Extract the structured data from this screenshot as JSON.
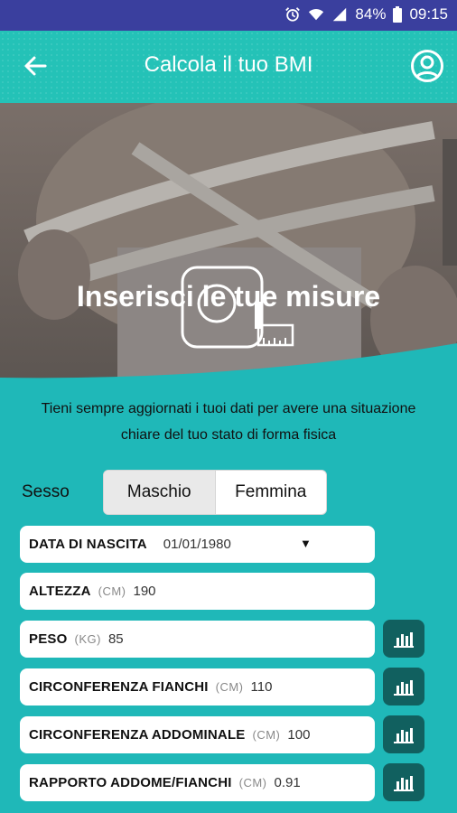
{
  "status": {
    "battery": "84%",
    "time": "09:15"
  },
  "appbar": {
    "title": "Calcola il tuo BMI"
  },
  "hero": {
    "heading": "Inserisci le tue misure"
  },
  "intro": {
    "line1": "Tieni sempre aggiornati i tuoi dati per avere una situazione",
    "line2": "chiare del tuo stato di forma fisica"
  },
  "sex": {
    "label": "Sesso",
    "options": [
      "Maschio",
      "Femmina"
    ],
    "selected": "Maschio"
  },
  "fields": {
    "birth": {
      "label": "DATA DI NASCITA",
      "value": "01/01/1980"
    },
    "height": {
      "label": "ALTEZZA",
      "unit": "(CM)",
      "value": "190"
    },
    "weight": {
      "label": "PESO",
      "unit": "(KG)",
      "value": "85"
    },
    "hips": {
      "label": "CIRCONFERENZA FIANCHI",
      "unit": "(CM)",
      "value": "110"
    },
    "abdomen": {
      "label": "CIRCONFERENZA ADDOMINALE",
      "unit": "(CM)",
      "value": "100"
    },
    "ratio": {
      "label": "RAPPORTO ADDOME/FIANCHI",
      "unit": "(CM)",
      "value": "0.91"
    }
  },
  "icons": {
    "back": "arrow-left-icon",
    "profile": "account-circle-icon",
    "chart": "bar-chart-icon",
    "dropdown": "triangle-down-icon"
  },
  "colors": {
    "statusbar": "#3a3f9e",
    "appbar": "#24c2b7",
    "background": "#1fb8b8",
    "chart_button": "#11605f"
  }
}
